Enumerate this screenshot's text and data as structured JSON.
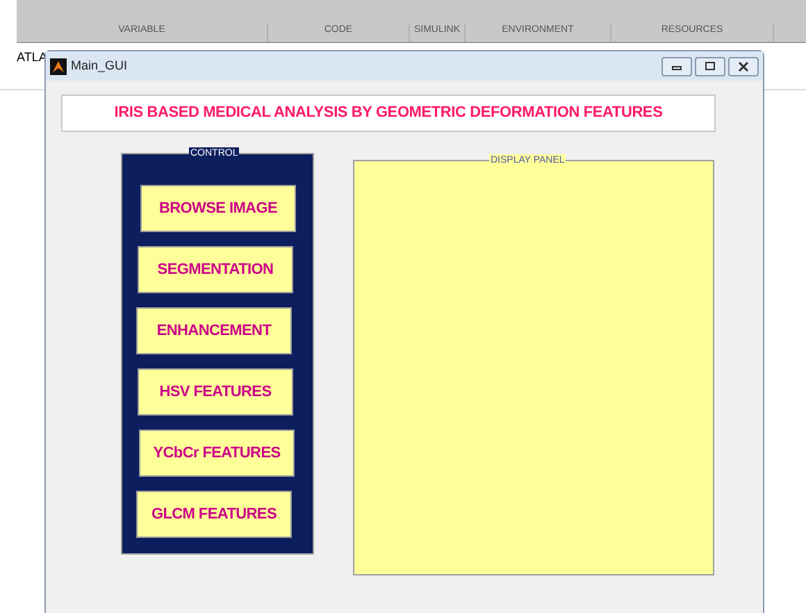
{
  "toolstrip": {
    "sections": [
      "VARIABLE",
      "CODE",
      "SIMULINK",
      "ENVIRONMENT",
      "RESOURCES"
    ]
  },
  "background_text": "ATLA",
  "window": {
    "title": "Main_GUI"
  },
  "heading": "IRIS BASED MEDICAL ANALYSIS BY GEOMETRIC DEFORMATION FEATURES",
  "control_panel": {
    "title": "CONTROL",
    "buttons": [
      "BROWSE IMAGE",
      "SEGMENTATION",
      "ENHANCEMENT",
      "HSV FEATURES",
      "YCbCr FEATURES",
      "GLCM FEATURES"
    ]
  },
  "display_panel": {
    "title": "DISPLAY PANEL"
  }
}
